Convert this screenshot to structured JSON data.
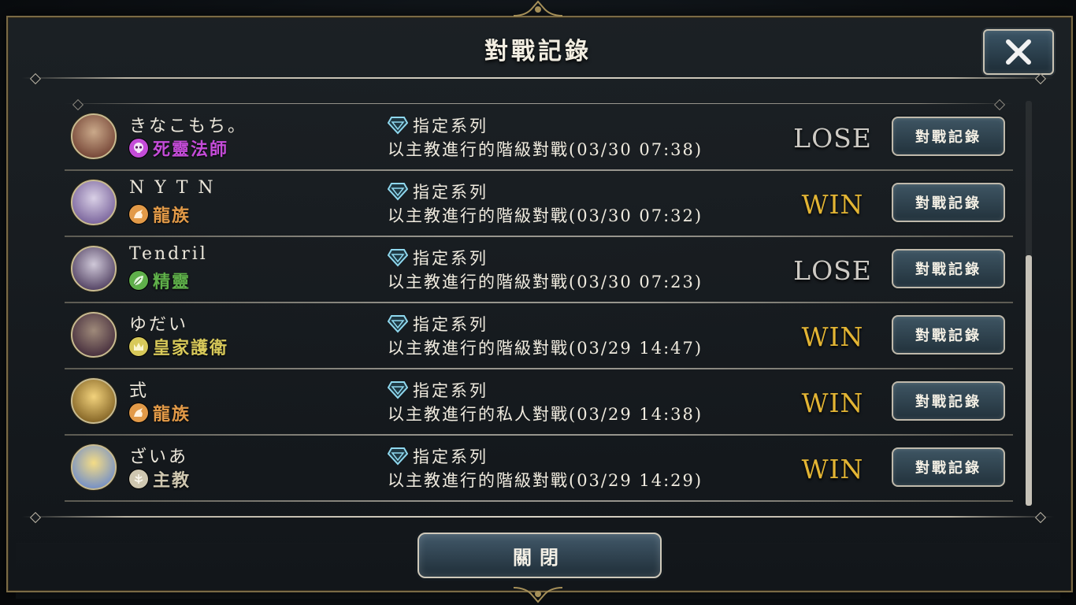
{
  "dialog": {
    "title": "對戰記錄",
    "close_label": "關閉"
  },
  "colors": {
    "win": "#e3b534",
    "lose": "#cdcac4",
    "necromancer": "#c44cd8",
    "dragon": "#e29a48",
    "elf": "#5fb04a",
    "royal": "#d8c95a",
    "bishop": "#cfc7b0"
  },
  "matches": [
    {
      "player": "きなこもち。",
      "class_name": "死靈法師",
      "class_icon": "skull-icon",
      "class_color": "#c44cd8",
      "mode": "指定系列",
      "description": "以主教進行的階級對戰(03/30 07:38)",
      "result": "LOSE",
      "button": "對戰記錄"
    },
    {
      "player": "N Y T N",
      "class_name": "龍族",
      "class_icon": "dragon-icon",
      "class_color": "#e29a48",
      "mode": "指定系列",
      "description": "以主教進行的階級對戰(03/30 07:32)",
      "result": "WIN",
      "button": "對戰記錄"
    },
    {
      "player": "Tendril",
      "class_name": "精靈",
      "class_icon": "leaf-icon",
      "class_color": "#5fb04a",
      "mode": "指定系列",
      "description": "以主教進行的階級對戰(03/30 07:23)",
      "result": "LOSE",
      "button": "對戰記錄"
    },
    {
      "player": "ゆだい",
      "class_name": "皇家護衛",
      "class_icon": "crown-icon",
      "class_color": "#d8c95a",
      "mode": "指定系列",
      "description": "以主教進行的階級對戰(03/29 14:47)",
      "result": "WIN",
      "button": "對戰記錄"
    },
    {
      "player": "式",
      "class_name": "龍族",
      "class_icon": "dragon-icon",
      "class_color": "#e29a48",
      "mode": "指定系列",
      "description": "以主教進行的私人對戰(03/29 14:38)",
      "result": "WIN",
      "button": "對戰記錄"
    },
    {
      "player": "ざいあ",
      "class_name": "主教",
      "class_icon": "bishop-icon",
      "class_color": "#cfc7b0",
      "mode": "指定系列",
      "description": "以主教進行的階級對戰(03/29 14:29)",
      "result": "WIN",
      "button": "對戰記錄"
    }
  ]
}
